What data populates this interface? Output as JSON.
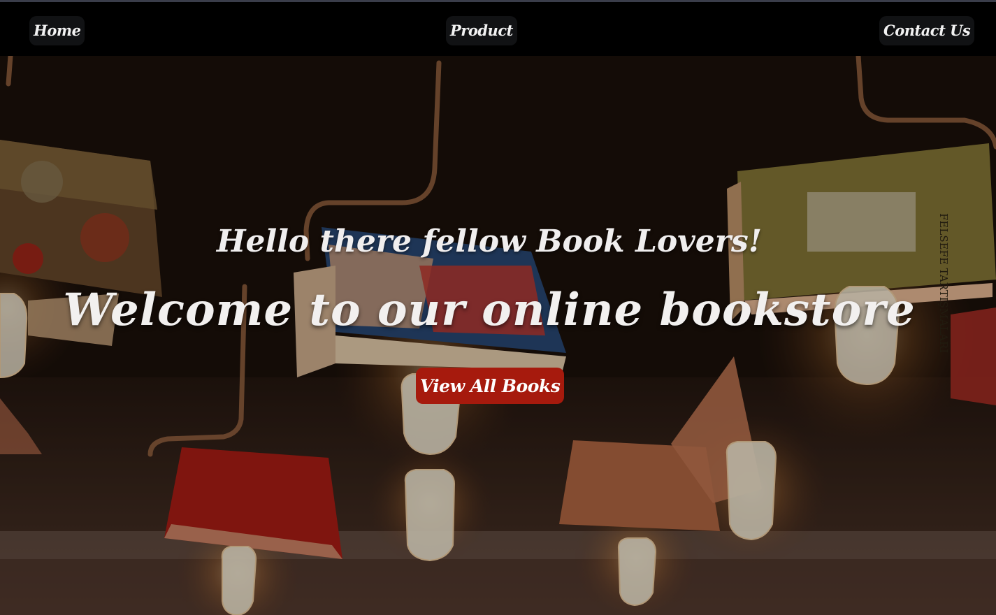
{
  "nav": {
    "home": "Home",
    "product": "Product",
    "contact": "Contact Us"
  },
  "hero": {
    "greeting": "Hello there fellow Book Lovers!",
    "headline": "Welcome to our online bookstore",
    "cta_label": "View All Books",
    "book_cover_text": "FELSEFE TARTIŞMALARI"
  },
  "colors": {
    "navbar": "#000000",
    "cta": "#a61a0d",
    "text": "#f2f0ef"
  },
  "icons": [
    "hanging-book-lamp-icon",
    "light-bulb-icon"
  ]
}
